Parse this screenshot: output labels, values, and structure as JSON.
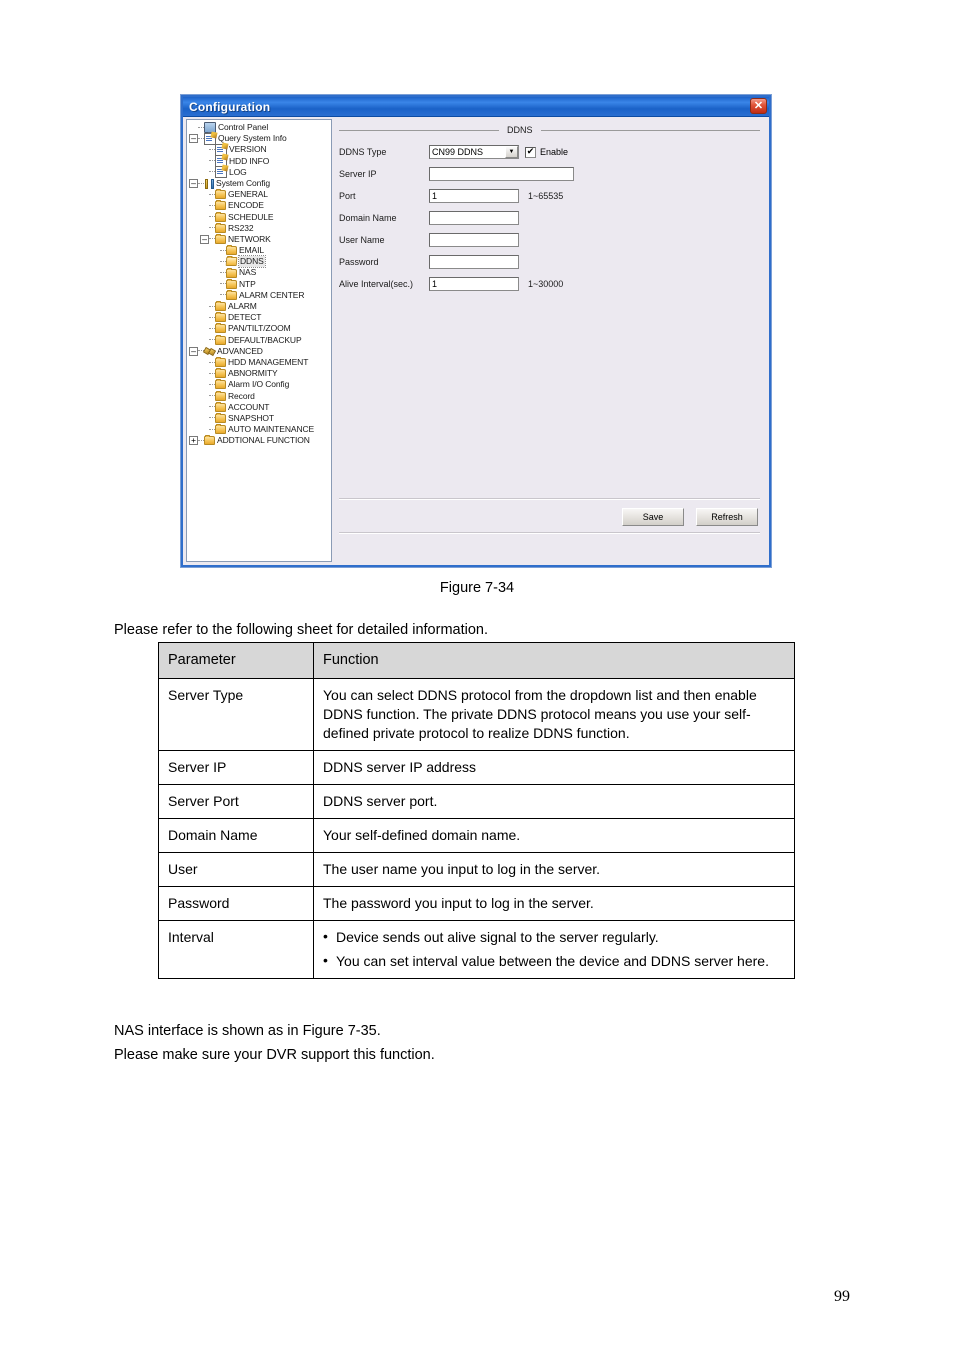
{
  "dialog": {
    "title": "Configuration",
    "close_icon": "close-icon",
    "tree": [
      {
        "label": "Control Panel",
        "depth": 0,
        "icon": "monitor-icon",
        "expander": "none",
        "selected": false
      },
      {
        "label": "Query System Info",
        "depth": 0,
        "icon": "note-icon",
        "expander": "minus",
        "selected": false
      },
      {
        "label": "VERSION",
        "depth": 1,
        "icon": "note-icon",
        "expander": "none",
        "selected": false
      },
      {
        "label": "HDD INFO",
        "depth": 1,
        "icon": "note-icon",
        "expander": "none",
        "selected": false
      },
      {
        "label": "LOG",
        "depth": 1,
        "icon": "note-icon",
        "expander": "none",
        "selected": false
      },
      {
        "label": "System Config",
        "depth": 0,
        "icon": "tools-icon",
        "expander": "minus",
        "selected": false
      },
      {
        "label": "GENERAL",
        "depth": 1,
        "icon": "folder-icon",
        "expander": "none",
        "selected": false
      },
      {
        "label": "ENCODE",
        "depth": 1,
        "icon": "folder-icon",
        "expander": "none",
        "selected": false
      },
      {
        "label": "SCHEDULE",
        "depth": 1,
        "icon": "folder-icon",
        "expander": "none",
        "selected": false
      },
      {
        "label": "RS232",
        "depth": 1,
        "icon": "folder-icon",
        "expander": "none",
        "selected": false
      },
      {
        "label": "NETWORK",
        "depth": 1,
        "icon": "folder-icon",
        "expander": "minus",
        "selected": false
      },
      {
        "label": "EMAIL",
        "depth": 2,
        "icon": "folder-icon",
        "expander": "none",
        "selected": false
      },
      {
        "label": "DDNS",
        "depth": 2,
        "icon": "folder-open-icon",
        "expander": "none",
        "selected": true
      },
      {
        "label": "NAS",
        "depth": 2,
        "icon": "folder-icon",
        "expander": "none",
        "selected": false
      },
      {
        "label": "NTP",
        "depth": 2,
        "icon": "folder-icon",
        "expander": "none",
        "selected": false
      },
      {
        "label": "ALARM CENTER",
        "depth": 2,
        "icon": "folder-icon",
        "expander": "none",
        "selected": false
      },
      {
        "label": "ALARM",
        "depth": 1,
        "icon": "folder-icon",
        "expander": "none",
        "selected": false
      },
      {
        "label": "DETECT",
        "depth": 1,
        "icon": "folder-icon",
        "expander": "none",
        "selected": false
      },
      {
        "label": "PAN/TILT/ZOOM",
        "depth": 1,
        "icon": "folder-icon",
        "expander": "none",
        "selected": false
      },
      {
        "label": "DEFAULT/BACKUP",
        "depth": 1,
        "icon": "folder-icon",
        "expander": "none",
        "selected": false
      },
      {
        "label": "ADVANCED",
        "depth": 0,
        "icon": "gears-icon",
        "expander": "minus",
        "selected": false
      },
      {
        "label": "HDD MANAGEMENT",
        "depth": 1,
        "icon": "folder-icon",
        "expander": "none",
        "selected": false
      },
      {
        "label": "ABNORMITY",
        "depth": 1,
        "icon": "folder-icon",
        "expander": "none",
        "selected": false
      },
      {
        "label": "Alarm I/O Config",
        "depth": 1,
        "icon": "folder-icon",
        "expander": "none",
        "selected": false
      },
      {
        "label": "Record",
        "depth": 1,
        "icon": "folder-icon",
        "expander": "none",
        "selected": false
      },
      {
        "label": "ACCOUNT",
        "depth": 1,
        "icon": "folder-icon",
        "expander": "none",
        "selected": false
      },
      {
        "label": "SNAPSHOT",
        "depth": 1,
        "icon": "folder-icon",
        "expander": "none",
        "selected": false
      },
      {
        "label": "AUTO MAINTENANCE",
        "depth": 1,
        "icon": "folder-icon",
        "expander": "none",
        "selected": false
      },
      {
        "label": "ADDTIONAL FUNCTION",
        "depth": 0,
        "icon": "folder-icon",
        "expander": "plus",
        "selected": false
      }
    ],
    "panel": {
      "section_title": "DDNS",
      "ddns_type": {
        "label": "DDNS Type",
        "value": "CN99 DDNS",
        "arrow": "▼"
      },
      "enable": {
        "label": "Enable",
        "checked": true,
        "check_glyph": "✔"
      },
      "fields": [
        {
          "label": "Server IP",
          "value": "",
          "hint": "",
          "width": "wide"
        },
        {
          "label": "Port",
          "value": "1",
          "hint": "1~65535",
          "width": "normal"
        },
        {
          "label": "Domain Name",
          "value": "",
          "hint": "",
          "width": "normal"
        },
        {
          "label": "User Name",
          "value": "",
          "hint": "",
          "width": "normal"
        },
        {
          "label": "Password",
          "value": "",
          "hint": "",
          "width": "normal"
        },
        {
          "label": "Alive Interval(sec.)",
          "value": "1",
          "hint": "1~30000",
          "width": "normal"
        }
      ],
      "buttons": {
        "save": "Save",
        "refresh": "Refresh"
      }
    }
  },
  "document": {
    "figure_caption": "Figure 7-34",
    "intro_line": "Please refer to the following sheet for detailed information.",
    "table": {
      "headers": [
        "Parameter",
        "Function"
      ],
      "rows": [
        {
          "parameter": "Server Type",
          "function": "You can select DDNS protocol from the dropdown list and then enable DDNS function. The private DDNS protocol means you use your self-defined private protocol to realize DDNS function."
        },
        {
          "parameter": "Server IP",
          "function": "DDNS server IP address"
        },
        {
          "parameter": "Server Port",
          "function": "DDNS server port."
        },
        {
          "parameter": "Domain Name",
          "function": "Your self-defined domain name."
        },
        {
          "parameter": "User",
          "function": "The user name you input to log in the server."
        },
        {
          "parameter": "Password",
          "function": "The password you input to log in the server."
        },
        {
          "parameter": "Interval",
          "bullets": [
            "Device sends out alive signal to the server regularly.",
            "You can set interval value between the device and DDNS server here."
          ]
        }
      ]
    },
    "outro_lines": [
      "NAS interface is shown as in Figure 7-35.",
      "Please make sure your DVR support this function."
    ],
    "page_number": "99"
  }
}
